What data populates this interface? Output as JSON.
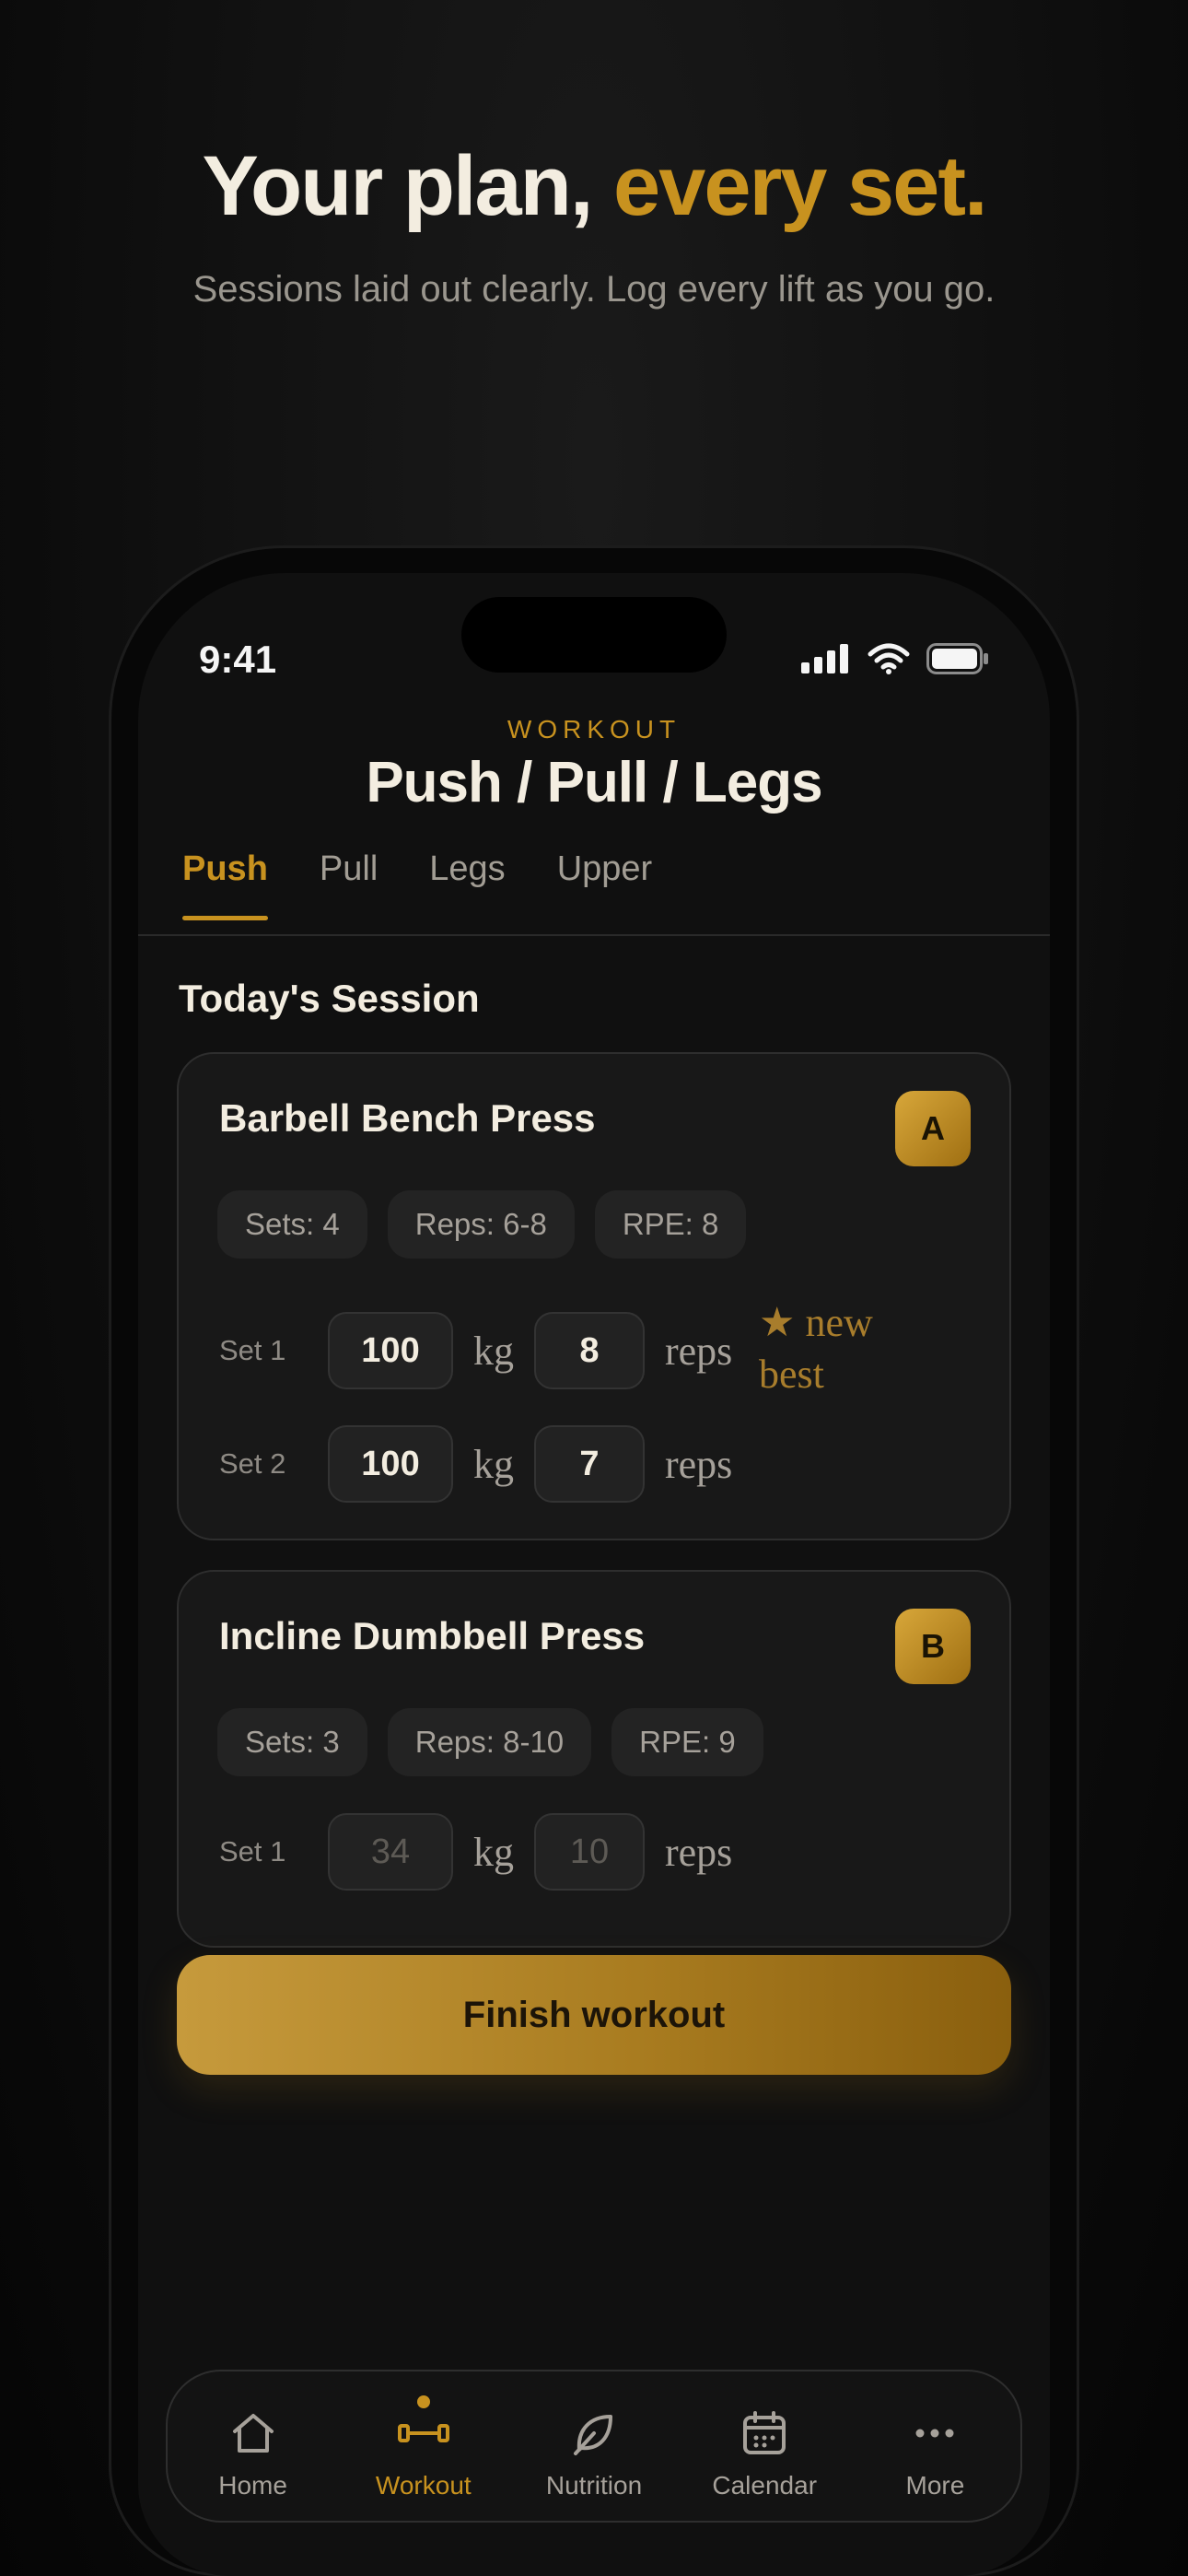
{
  "promo": {
    "headline_main": "Your plan,",
    "headline_accent": "every set.",
    "subheadline": "Sessions laid out clearly. Log every lift as you go."
  },
  "status_bar": {
    "time": "9:41",
    "icons": [
      "cellular-signal-icon",
      "wifi-icon",
      "battery-icon"
    ]
  },
  "header": {
    "eyebrow": "WORKOUT",
    "title": "Push / Pull / Legs"
  },
  "tabs": [
    {
      "label": "Push",
      "active": true
    },
    {
      "label": "Pull",
      "active": false
    },
    {
      "label": "Legs",
      "active": false
    },
    {
      "label": "Upper",
      "active": false
    }
  ],
  "session": {
    "title": "Today's Session",
    "exercises": [
      {
        "name": "Barbell Bench Press",
        "badge": "A",
        "pills": [
          "Sets: 4",
          "Reps: 6-8",
          "RPE: 8"
        ],
        "sets": [
          {
            "label": "Set 1",
            "weight": "100",
            "weight_unit": "kg",
            "reps": "8",
            "reps_unit": "reps",
            "note": "★ new best"
          },
          {
            "label": "Set 2",
            "weight": "100",
            "weight_unit": "kg",
            "reps": "7",
            "reps_unit": "reps"
          }
        ]
      },
      {
        "name": "Incline Dumbbell Press",
        "badge": "B",
        "pills": [
          "Sets: 3",
          "Reps: 8-10",
          "RPE: 9"
        ],
        "sets": [
          {
            "label": "Set 1",
            "weight_placeholder": "34",
            "weight_unit": "kg",
            "reps_placeholder": "10",
            "reps_unit": "reps"
          }
        ]
      }
    ]
  },
  "finish_button": "Finish workout",
  "bottom_nav": [
    {
      "label": "Home",
      "icon": "home-icon",
      "active": false
    },
    {
      "label": "Workout",
      "icon": "dumbbell-icon",
      "active": true
    },
    {
      "label": "Nutrition",
      "icon": "leaf-icon",
      "active": false
    },
    {
      "label": "Calendar",
      "icon": "calendar-icon",
      "active": false
    },
    {
      "label": "More",
      "icon": "more-icon",
      "active": false
    }
  ],
  "colors": {
    "accent": "#c8921f",
    "background": "#101010",
    "card": "#181818",
    "text": "#f3ede0",
    "muted": "#a6a19a"
  }
}
